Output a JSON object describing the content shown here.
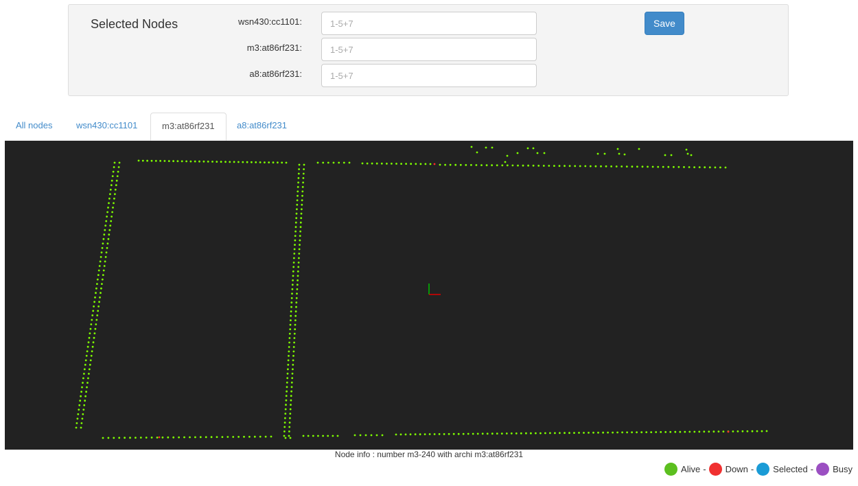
{
  "selection": {
    "title": "Selected Nodes",
    "fields": [
      {
        "label": "wsn430:cc1101:",
        "placeholder": "1-5+7",
        "value": ""
      },
      {
        "label": "m3:at86rf231:",
        "placeholder": "1-5+7",
        "value": ""
      },
      {
        "label": "a8:at86rf231:",
        "placeholder": "1-5+7",
        "value": ""
      }
    ],
    "save_label": "Save"
  },
  "tabs": [
    {
      "label": "All nodes",
      "active": false
    },
    {
      "label": "wsn430:cc1101",
      "active": false
    },
    {
      "label": "m3:at86rf231",
      "active": true
    },
    {
      "label": "a8:at86rf231",
      "active": false
    }
  ],
  "map": {
    "colors": {
      "background": "#222222",
      "alive": "#7fff00",
      "down": "#ff2a2a",
      "axis_y": "#00c000",
      "axis_x": "#e00000"
    }
  },
  "node_info": "Node info : number m3-240 with archi m3:at86rf231",
  "legend": [
    {
      "label": "Alive",
      "color": "#5cbf1f"
    },
    {
      "label": "Down",
      "color": "#f03030"
    },
    {
      "label": "Selected",
      "color": "#1a9bd6"
    },
    {
      "label": "Busy",
      "color": "#9b4fc2"
    }
  ]
}
